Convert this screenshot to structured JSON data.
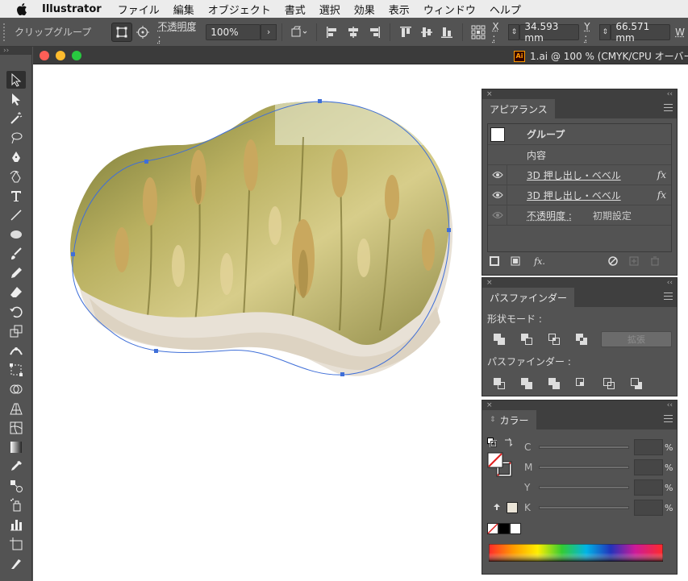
{
  "menubar": {
    "app_name": "Illustrator",
    "items": [
      "ファイル",
      "編集",
      "オブジェクト",
      "書式",
      "選択",
      "効果",
      "表示",
      "ウィンドウ",
      "ヘルプ"
    ]
  },
  "controlbar": {
    "selection_label": "クリップグループ",
    "opacity_label": "不透明度 :",
    "opacity_value": "100%",
    "x_label": "X :",
    "x_value": "34.593 mm",
    "y_label": "Y :",
    "y_value": "66.571 mm",
    "w_label": "W"
  },
  "document": {
    "title": "1.ai @ 100 % (CMYK/CPU オーバー",
    "ai_badge": "Ai"
  },
  "appearance_panel": {
    "tab": "アピアランス",
    "rows": [
      {
        "label": "グループ",
        "bold": true
      },
      {
        "label": "内容"
      },
      {
        "label": "3D 押し出し・ベベル",
        "fx": "fx"
      },
      {
        "label": "3D 押し出し・ベベル",
        "fx": "fx"
      },
      {
        "label": "不透明度 :",
        "value": "初期設定"
      }
    ],
    "footer_fx": "fx."
  },
  "pathfinder_panel": {
    "tab": "パスファインダー",
    "shape_modes_label": "形状モード :",
    "expand_label": "拡張",
    "pathfinders_label": "パスファインダー :"
  },
  "color_panel": {
    "tab": "カラー",
    "channels": [
      "C",
      "M",
      "Y",
      "K"
    ],
    "percent": "%",
    "swatch_color": "#ebe5d8"
  },
  "colors": {
    "wheat_light": "#d8cf8e",
    "wheat_dark": "#8f8a4a",
    "extrude_beige": "#e7e0d4",
    "path_blue": "#3f6fd8"
  }
}
